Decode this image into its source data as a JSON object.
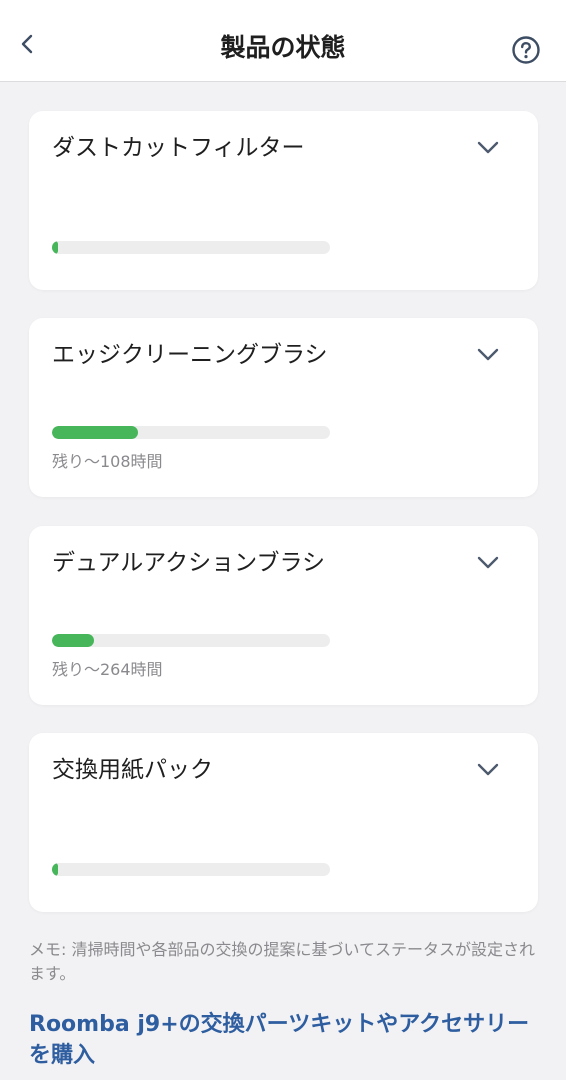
{
  "header": {
    "title": "製品の状態",
    "back_icon": "chevron-left-icon",
    "help_icon": "question-circle-icon"
  },
  "colors": {
    "progress_fill": "#47b65a",
    "progress_track": "#ededee",
    "link": "#2f5ea0",
    "muted_text": "#8a8a8e"
  },
  "items": [
    {
      "name": "ダストカットフィルター",
      "remaining": "",
      "progress": 0.02
    },
    {
      "name": "エッジクリーニングブラシ",
      "remaining": "残り〜108時間",
      "progress": 0.31
    },
    {
      "name": "デュアルアクションブラシ",
      "remaining": "残り〜264時間",
      "progress": 0.15
    },
    {
      "name": "交換用紙パック",
      "remaining": "",
      "progress": 0.02
    }
  ],
  "memo": "メモ: 清掃時間や各部品の交換の提案に基づいてステータスが設定されます。",
  "buy_link": "Roomba j9+の交換パーツキットやアクセサリーを購入"
}
